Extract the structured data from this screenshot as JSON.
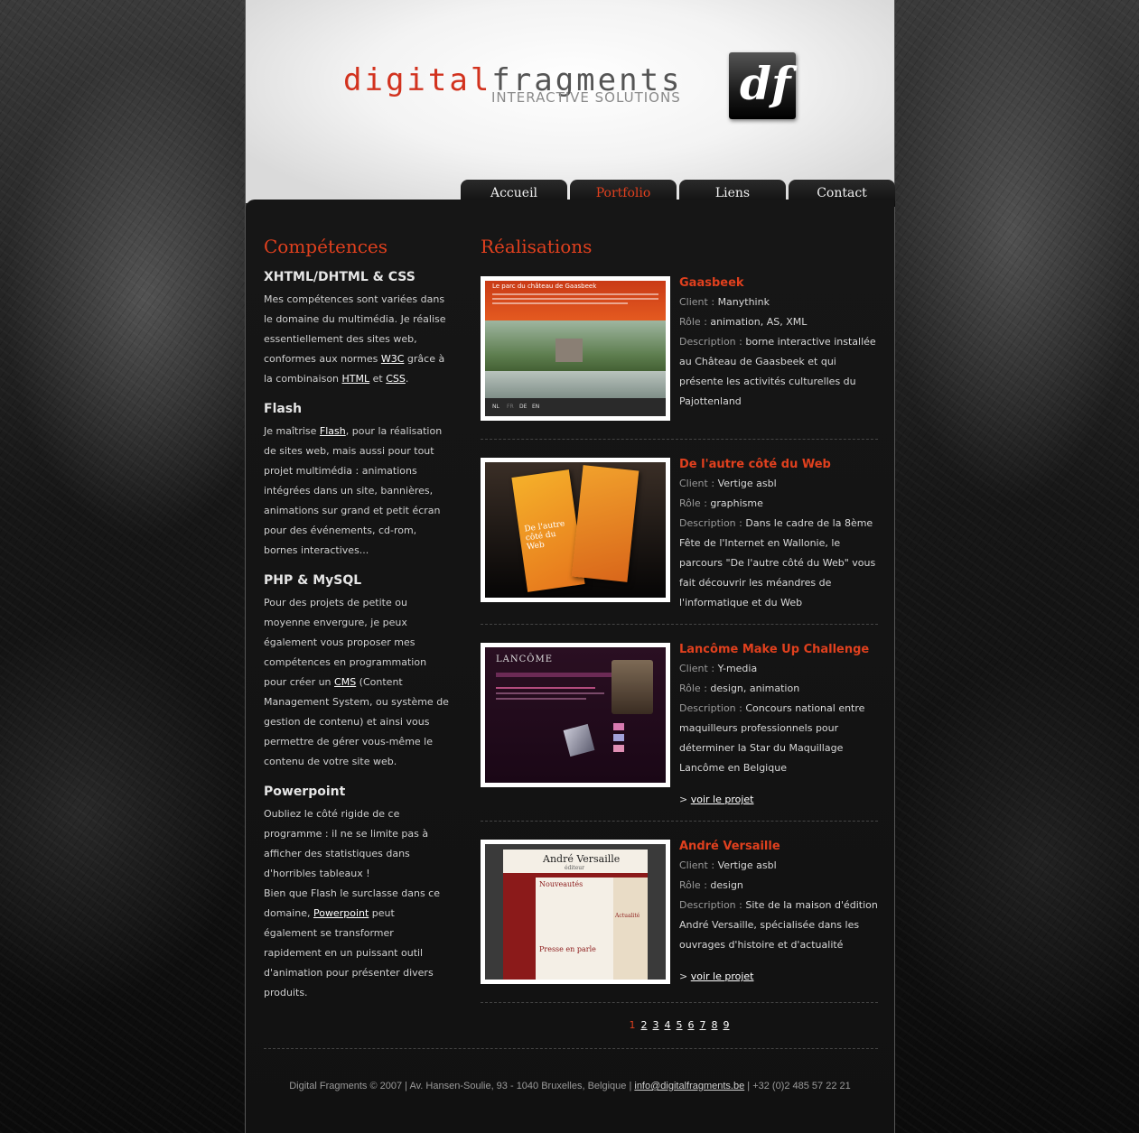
{
  "header": {
    "logo_word1": "digital",
    "logo_word2": "fragments",
    "logo_tagline": "INTERACTIVE SOLUTIONS",
    "logo_mark": "df"
  },
  "nav": {
    "items": [
      {
        "label": "Accueil",
        "active": false
      },
      {
        "label": "Portfolio",
        "active": true
      },
      {
        "label": "Liens",
        "active": false
      },
      {
        "label": "Contact",
        "active": false
      }
    ]
  },
  "competences": {
    "heading": "Compétences",
    "sections": [
      {
        "title": "XHTML/DHTML & CSS",
        "text_parts": [
          "Mes compétences sont variées dans le domaine du multimédia. Je réalise essentiellement des sites web, conformes aux normes ",
          "W3C",
          " grâce à la combinaison ",
          "HTML",
          " et ",
          "CSS",
          "."
        ]
      },
      {
        "title": "Flash",
        "text_parts": [
          "Je maîtrise ",
          "Flash",
          ", pour la réalisation de sites web, mais aussi pour tout projet multimédia : animations intégrées dans un site, bannières, animations sur grand et petit écran pour des événements, cd-rom, bornes interactives..."
        ]
      },
      {
        "title": "PHP & MySQL",
        "text_parts": [
          "Pour des projets de petite ou moyenne envergure, je peux également vous proposer mes compétences en programmation pour créer un ",
          "CMS",
          " (Content Management System, ou système de gestion de contenu) et ainsi vous permettre de gérer vous-même le contenu de votre site web."
        ]
      },
      {
        "title": "Powerpoint",
        "text_parts": [
          "Oubliez le côté rigide de ce programme : il ne se limite pas à afficher des statistiques dans d'horribles tableaux !",
          "Bien que Flash le surclasse dans ce domaine, ",
          "Powerpoint",
          " peut également se transformer rapidement en un puissant outil d'animation pour présenter divers produits."
        ]
      }
    ]
  },
  "realisations": {
    "heading": "Réalisations",
    "labels": {
      "client": "Client :",
      "role": "Rôle :",
      "description": "Description :"
    },
    "projects": [
      {
        "title": "Gaasbeek",
        "client": "Manythink",
        "role": "animation, AS, XML",
        "description": "borne interactive installée au Château de Gaasbeek et qui présente les activités culturelles du Pajottenland",
        "thumb_caption": "Le parc du château de Gaasbeek",
        "thumb_lang": [
          "NL",
          "FR",
          "DE",
          "EN"
        ]
      },
      {
        "title": "De l'autre côté du Web",
        "client": "Vertige asbl",
        "role": "graphisme",
        "description": "Dans le cadre de la 8ème Fête de l'Internet en Wallonie, le parcours \"De l'autre côté du Web\" vous fait découvrir les méandres de l'informatique et du Web",
        "thumb_caption": "De l'autre côté du Web"
      },
      {
        "title": "Lancôme Make Up Challenge",
        "client": "Y-media",
        "role": "design, animation",
        "description": "Concours national entre maquilleurs professionnels pour déterminer la Star du Maquillage Lancôme en Belgique",
        "link_prefix": ">",
        "link": "voir le projet",
        "thumb_caption": "LANCÔME"
      },
      {
        "title": "André Versaille",
        "client": "Vertige asbl",
        "role": "design",
        "description": "Site de la maison d'édition André Versaille, spécialisée dans les ouvrages d'histoire et d'actualité",
        "link_prefix": ">",
        "link": "voir le projet",
        "thumb_caption": "André Versaille",
        "thumb_sub": "éditeur",
        "thumb_h1": "Nouveautés",
        "thumb_h2": "Presse en parle",
        "thumb_h3": "Actualité"
      }
    ],
    "pagination": {
      "current": "1",
      "pages": [
        "2",
        "3",
        "4",
        "5",
        "6",
        "7",
        "8",
        "9"
      ]
    }
  },
  "footer": {
    "text": "Digital Fragments © 2007 | Av. Hansen-Soulie, 93 - 1040 Bruxelles, Belgique |",
    "email": "info@digitalfragments.be",
    "phone": "| +32 (0)2 485 57 22 21"
  }
}
